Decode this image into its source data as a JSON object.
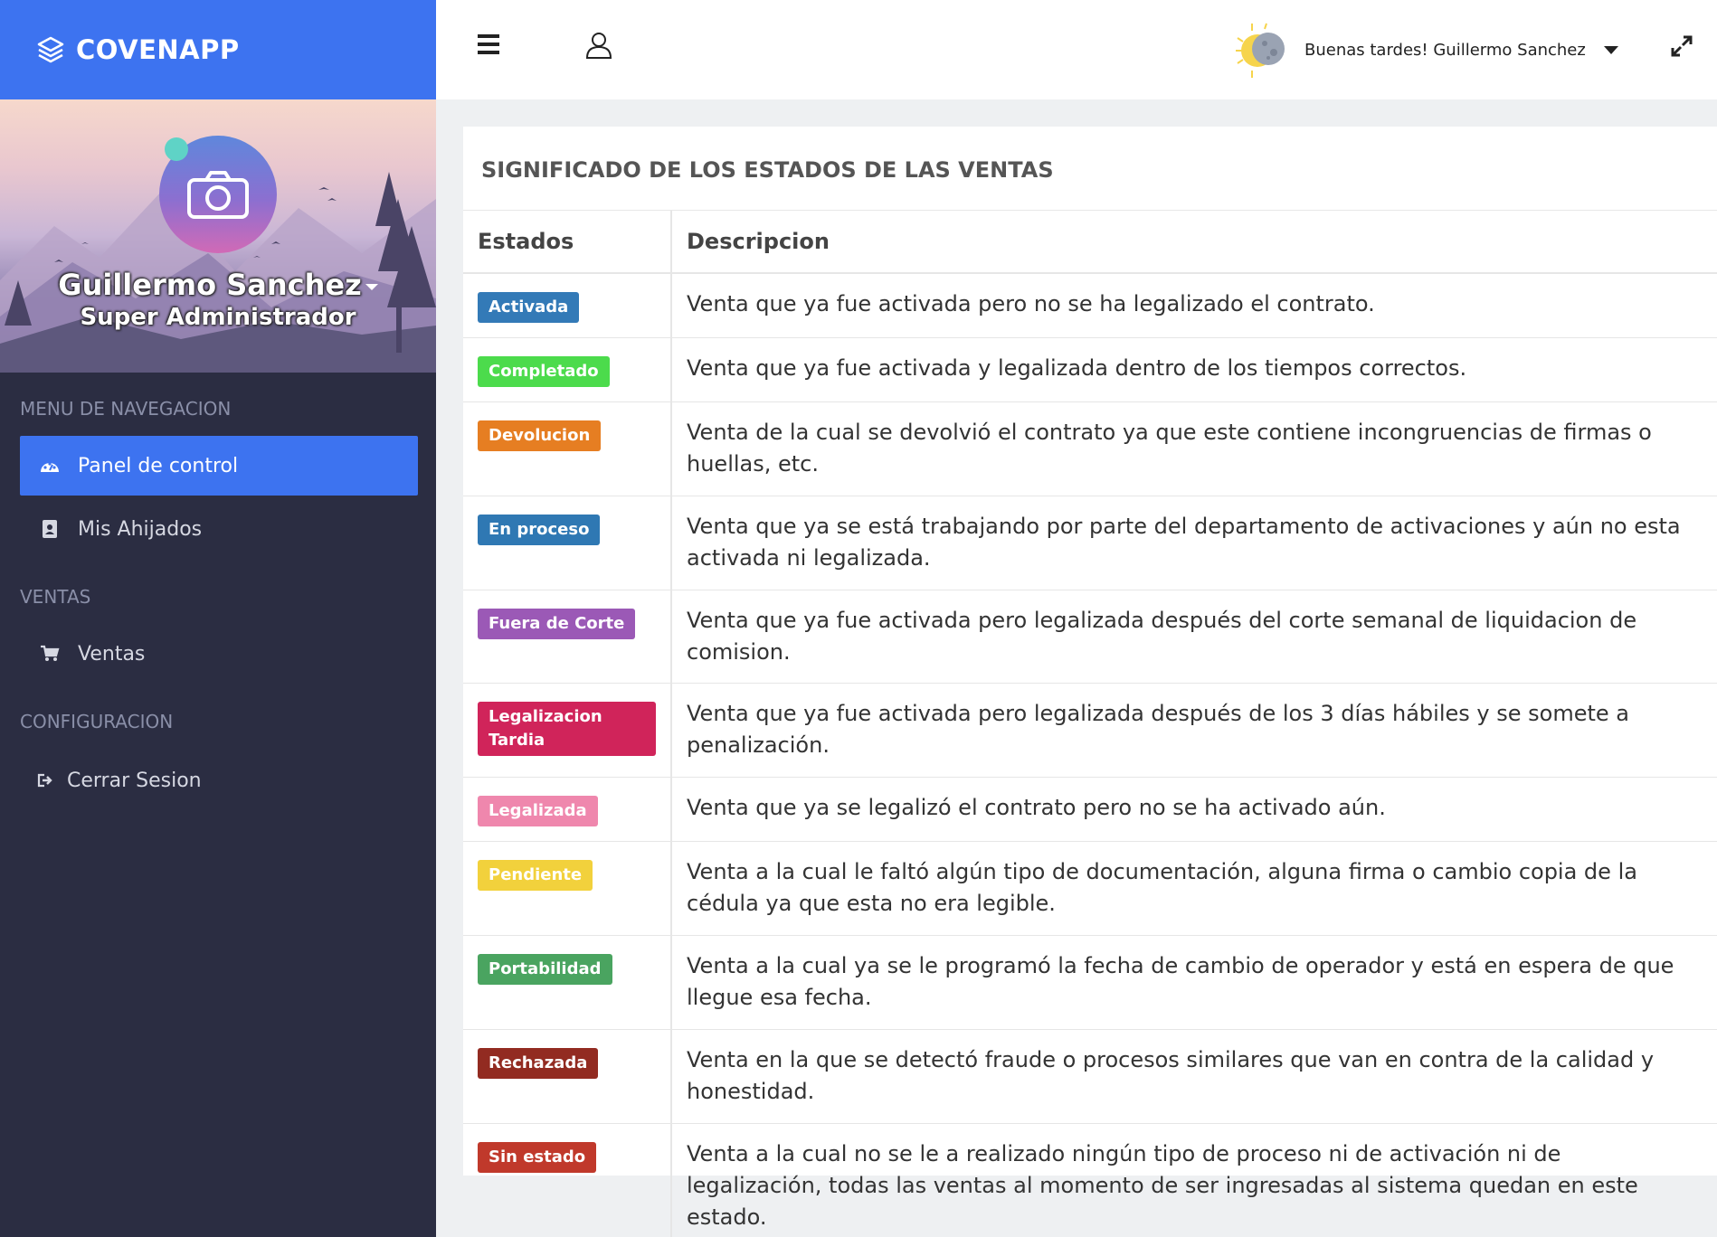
{
  "app": {
    "brand_name": "COVENAPP",
    "brand_icon": "layers-icon",
    "brand_color": "#3d73f0"
  },
  "profile": {
    "name": "Guillermo Sanchez",
    "role": "Super Administrador"
  },
  "sidebar": {
    "header_nav": "MENU DE NAVEGACION",
    "header_sales": "VENTAS",
    "header_config": "CONFIGURACION",
    "items": [
      {
        "label": "Panel de control",
        "icon": "dashboard-icon",
        "active": true
      },
      {
        "label": "Mis Ahijados",
        "icon": "address-book-icon",
        "active": false
      },
      {
        "label": "Ventas",
        "icon": "cart-icon",
        "active": false
      },
      {
        "label": "Cerrar Sesion",
        "icon": "sign-out-icon",
        "active": false
      }
    ]
  },
  "topbar": {
    "greeting": "Buenas tardes! Guillermo Sanchez",
    "icons": [
      "menu-icon",
      "user-icon",
      "sun-moon-icon",
      "caret-down-icon",
      "expand-icon"
    ]
  },
  "card": {
    "title": "SIGNIFICADO DE LOS ESTADOS DE LAS VENTAS",
    "columns": [
      "Estados",
      "Descripcion"
    ],
    "rows": [
      {
        "state": "Activada",
        "color": "#337ab7",
        "description": "Venta que ya fue activada pero no se ha legalizado el contrato."
      },
      {
        "state": "Completado",
        "color": "#4cdb4c",
        "description": "Venta que ya fue activada y legalizada dentro de los tiempos correctos."
      },
      {
        "state": "Devolucion",
        "color": "#e67e22",
        "description": "Venta de la cual se devolvió el contrato ya que este contiene incongruencias de firmas o huellas, etc."
      },
      {
        "state": "En proceso",
        "color": "#2f78b3",
        "description": "Venta que ya se está trabajando por parte del departamento de activaciones y aún no esta activada ni legalizada."
      },
      {
        "state": "Fuera de Corte",
        "color": "#9b59b6",
        "description": "Venta que ya fue activada pero legalizada después del corte semanal de liquidacion de comision."
      },
      {
        "state": "Legalizacion Tardia",
        "color": "#d0245a",
        "description": "Venta que ya fue activada pero legalizada después de los 3 días hábiles y se somete a penalización."
      },
      {
        "state": "Legalizada",
        "color": "#ef87ad",
        "description": "Venta que ya se legalizó el contrato pero no se ha activado aún."
      },
      {
        "state": "Pendiente",
        "color": "#f2d13c",
        "description": "Venta a la cual le faltó algún tipo de documentación, alguna firma o cambio copia de la cédula ya que esta no era legible."
      },
      {
        "state": "Portabilidad",
        "color": "#4aa460",
        "description": "Venta a la cual ya se le programó la fecha de cambio de operador y está en espera de que llegue esa fecha."
      },
      {
        "state": "Rechazada",
        "color": "#922b21",
        "description": "Venta en la que se detectó fraude o procesos similares que van en contra de la calidad y honestidad."
      },
      {
        "state": "Sin estado",
        "color": "#c0392b",
        "description": "Venta a la cual no se le a realizado ningún tipo de proceso ni de activación ni de legalización, todas las ventas al momento de ser ingresadas al sistema quedan en este estado."
      }
    ]
  }
}
